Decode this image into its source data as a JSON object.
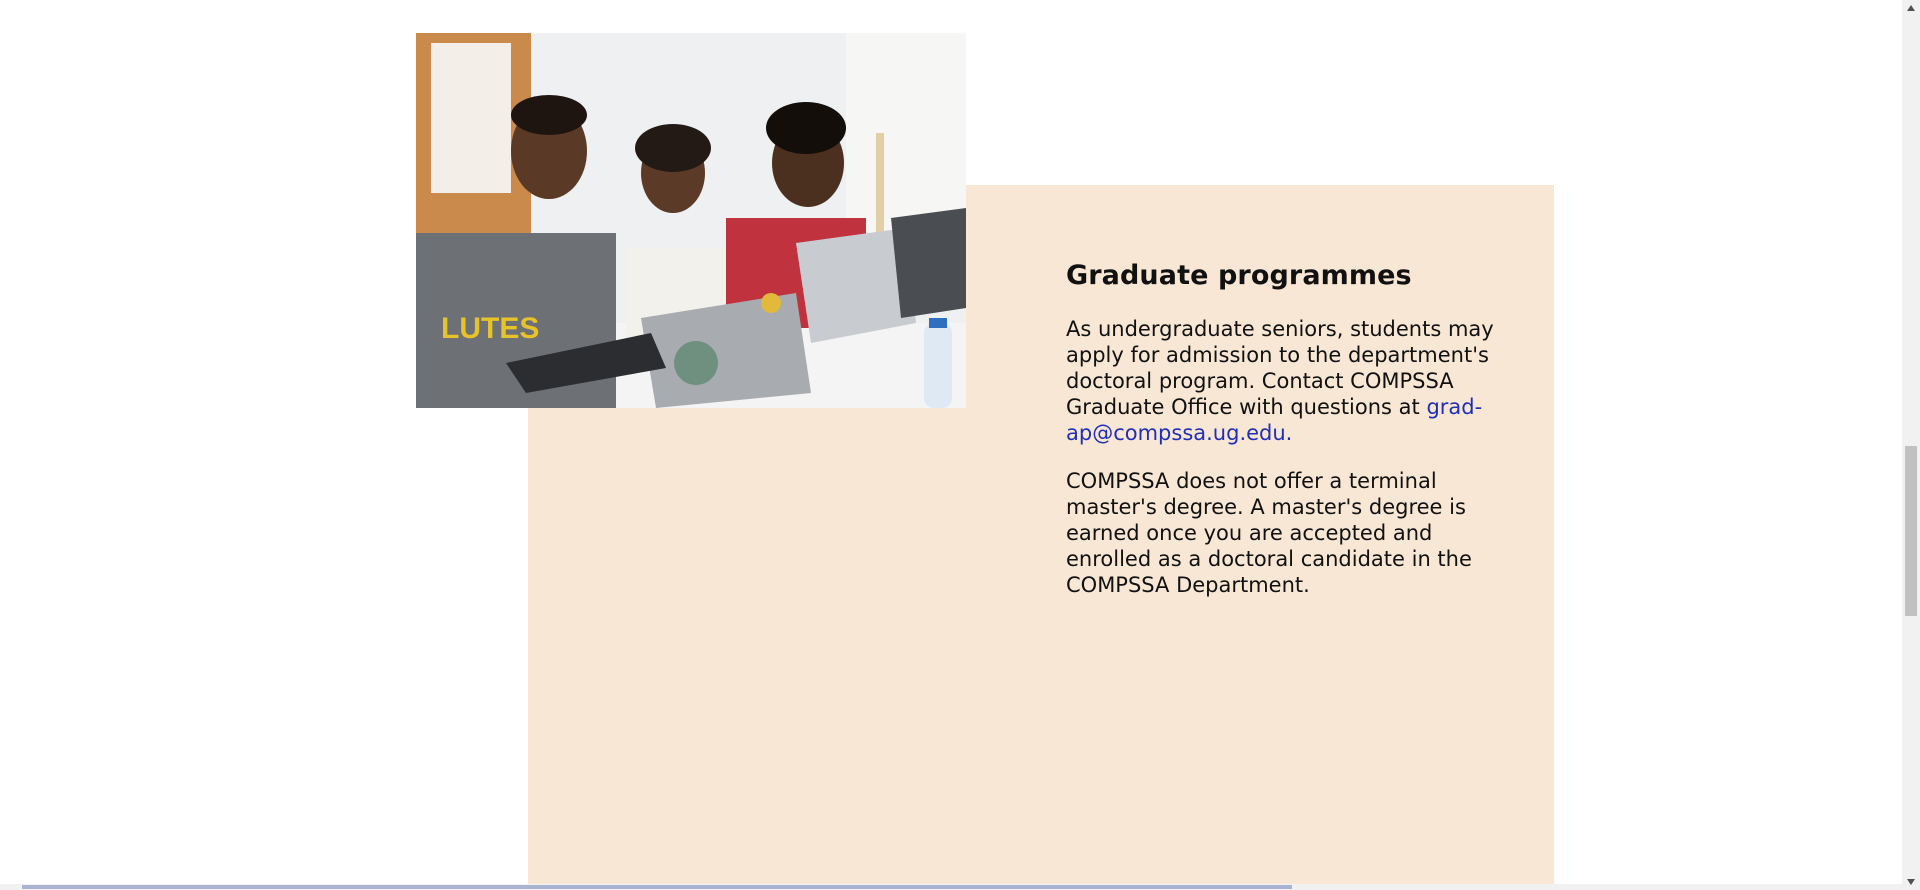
{
  "graduate": {
    "heading": "Graduate programmes",
    "para1_text": "As undergraduate seniors, students may apply for admission to the department's doctoral program. Contact COMPSSA Graduate Office with questions at",
    "email": "grad-ap@compssa.ug.edu.",
    "para2": "COMPSSA does not offer a terminal master's degree. A master's degree is earned once you are accepted and enrolled as a doctoral candidate in the COMPSSA Department."
  },
  "colors": {
    "panel_background": "#f8e7d4",
    "link": "#1f2fb7",
    "text": "#111111"
  },
  "icons": {
    "scroll_up": "arrow-up-icon",
    "scroll_down": "arrow-down-icon"
  }
}
